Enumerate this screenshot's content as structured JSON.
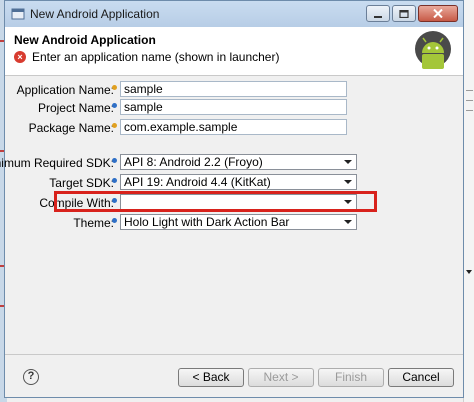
{
  "window": {
    "title": "New Android Application"
  },
  "banner": {
    "title": "New Android Application",
    "message": "Enter an application name (shown in launcher)"
  },
  "form": {
    "application_name": {
      "label": "Application Name:",
      "value": "sample"
    },
    "project_name": {
      "label": "Project Name:",
      "value": "sample"
    },
    "package_name": {
      "label": "Package Name:",
      "value": "com.example.sample"
    },
    "min_sdk": {
      "label": "Minimum Required SDK:",
      "value": "API 8: Android 2.2 (Froyo)"
    },
    "target_sdk": {
      "label": "Target SDK:",
      "value": "API 19: Android 4.4 (KitKat)"
    },
    "compile_with": {
      "label": "Compile With:",
      "value": ""
    },
    "theme": {
      "label": "Theme:",
      "value": "Holo Light with Dark Action Bar"
    }
  },
  "footer": {
    "help": "?",
    "back": "< Back",
    "next": "Next >",
    "finish": "Finish",
    "cancel": "Cancel"
  },
  "colors": {
    "highlight": "#d8221c",
    "error": "#d83b2f",
    "android_green": "#a4c639"
  }
}
